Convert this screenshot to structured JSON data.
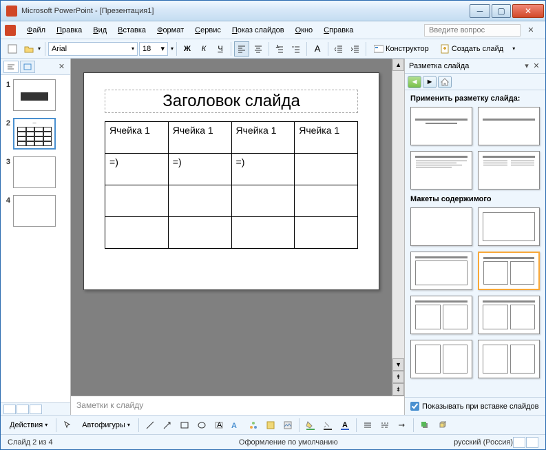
{
  "title": "Microsoft PowerPoint - [Презентация1]",
  "menubar": [
    "Файл",
    "Правка",
    "Вид",
    "Вставка",
    "Формат",
    "Сервис",
    "Показ слайдов",
    "Окно",
    "Справка"
  ],
  "help_placeholder": "Введите вопрос",
  "toolbar": {
    "font": "Arial",
    "size": "18",
    "designer": "Конструктор",
    "new_slide": "Создать слайд"
  },
  "thumbs": [
    1,
    2,
    3,
    4
  ],
  "selected_thumb": 2,
  "slide": {
    "title": "Заголовок слайда",
    "table": [
      [
        "Ячейка 1",
        "Ячейка 1",
        "Ячейка 1",
        "Ячейка 1"
      ],
      [
        "=)",
        "=)",
        "=)",
        ""
      ],
      [
        "",
        "",
        "",
        ""
      ],
      [
        "",
        "",
        "",
        ""
      ]
    ]
  },
  "notes_placeholder": "Заметки к слайду",
  "right_panel": {
    "title": "Разметка слайда",
    "apply": "Применить разметку слайда:",
    "section2": "Макеты содержимого",
    "checkbox": "Показывать при вставке слайдов"
  },
  "footer": {
    "actions": "Действия",
    "autoshapes": "Автофигуры"
  },
  "status": {
    "pos": "Слайд 2 из 4",
    "design": "Оформление по умолчанию",
    "lang": "русский (Россия)"
  }
}
